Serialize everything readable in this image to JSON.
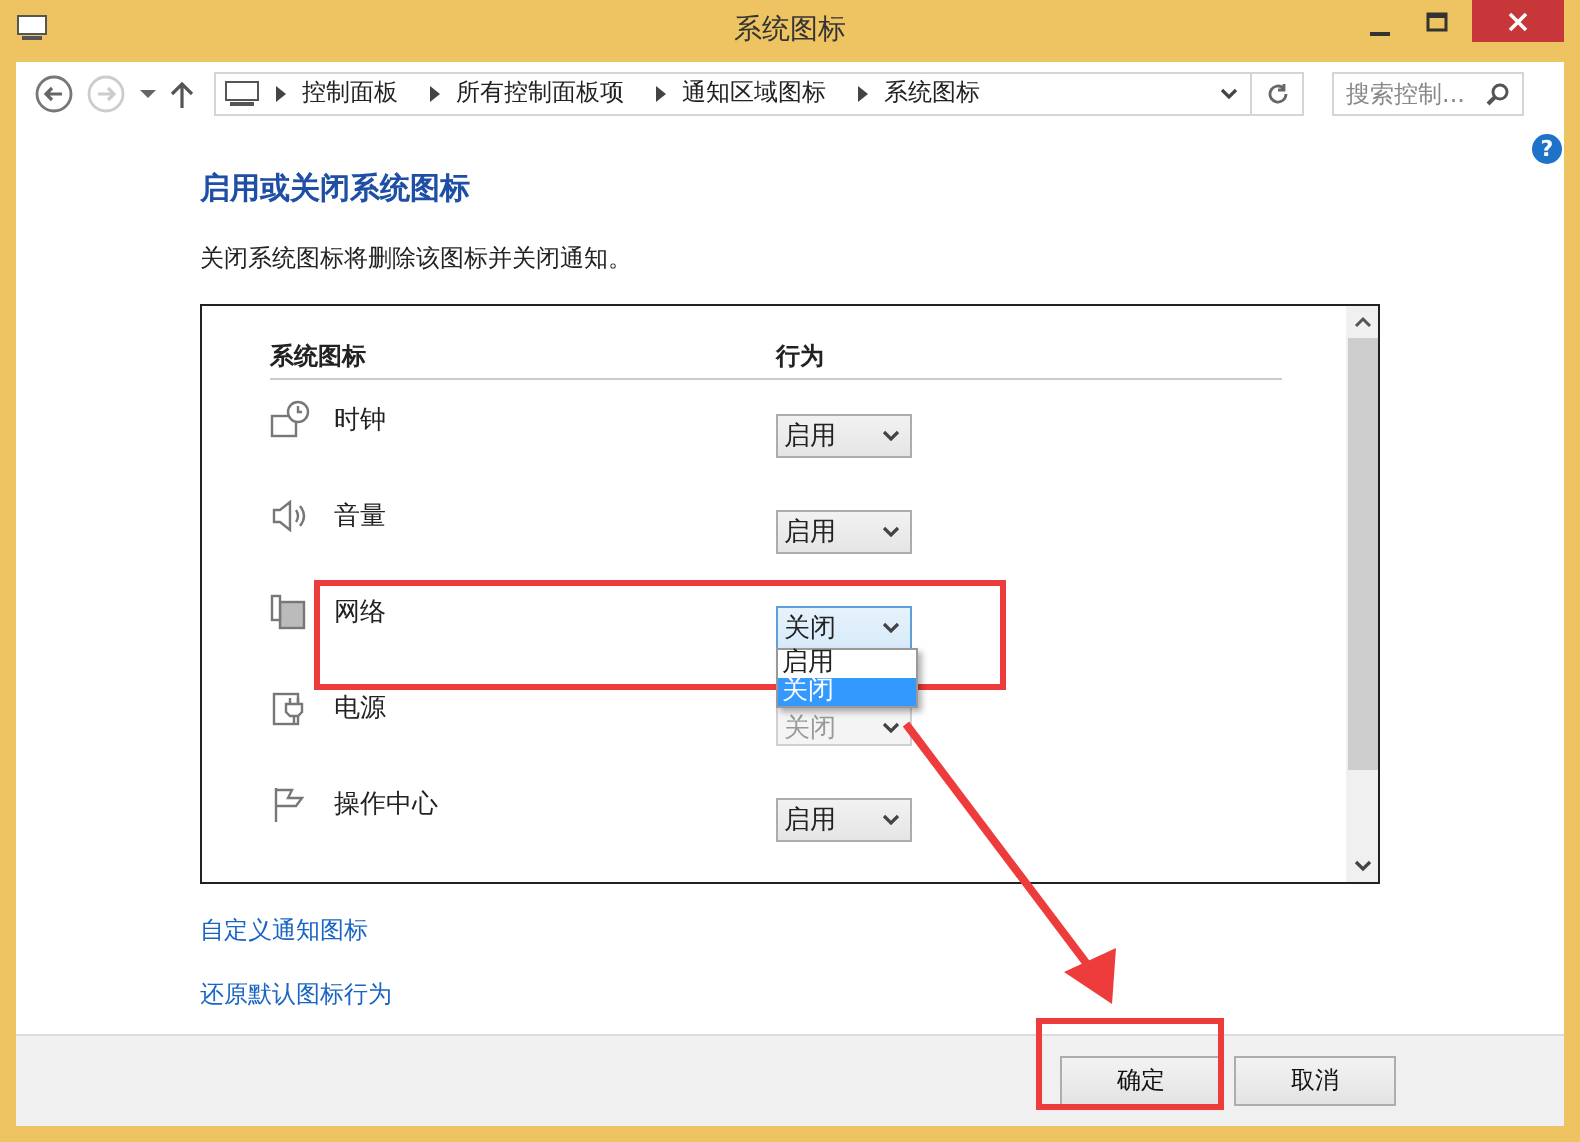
{
  "window": {
    "title": "系统图标"
  },
  "address_bar": {
    "crumbs": [
      "控制面板",
      "所有控制面板项",
      "通知区域图标",
      "系统图标"
    ]
  },
  "search": {
    "placeholder": "搜索控制..."
  },
  "help": "?",
  "heading": "启用或关闭系统图标",
  "description": "关闭系统图标将删除该图标并关闭通知。",
  "table": {
    "columns": [
      "系统图标",
      "行为"
    ],
    "rows": [
      {
        "kind": "clock",
        "name": "时钟",
        "value": "启用",
        "disabled": false,
        "expanded": false,
        "highlighted": false
      },
      {
        "kind": "volume",
        "name": "音量",
        "value": "启用",
        "disabled": false,
        "expanded": false,
        "highlighted": false
      },
      {
        "kind": "network",
        "name": "网络",
        "value": "关闭",
        "disabled": false,
        "expanded": true,
        "highlighted": true,
        "options": [
          {
            "label": "启用",
            "selected": false
          },
          {
            "label": "关闭",
            "selected": true
          }
        ]
      },
      {
        "kind": "power",
        "name": "电源",
        "value": "关闭",
        "disabled": true,
        "expanded": false,
        "highlighted": false
      },
      {
        "kind": "flag",
        "name": "操作中心",
        "value": "启用",
        "disabled": false,
        "expanded": false,
        "highlighted": false
      }
    ]
  },
  "links": [
    "自定义通知图标",
    "还原默认图标行为"
  ],
  "buttons": [
    {
      "label": "确定",
      "highlighted": true
    },
    {
      "label": "取消",
      "highlighted": false
    }
  ]
}
